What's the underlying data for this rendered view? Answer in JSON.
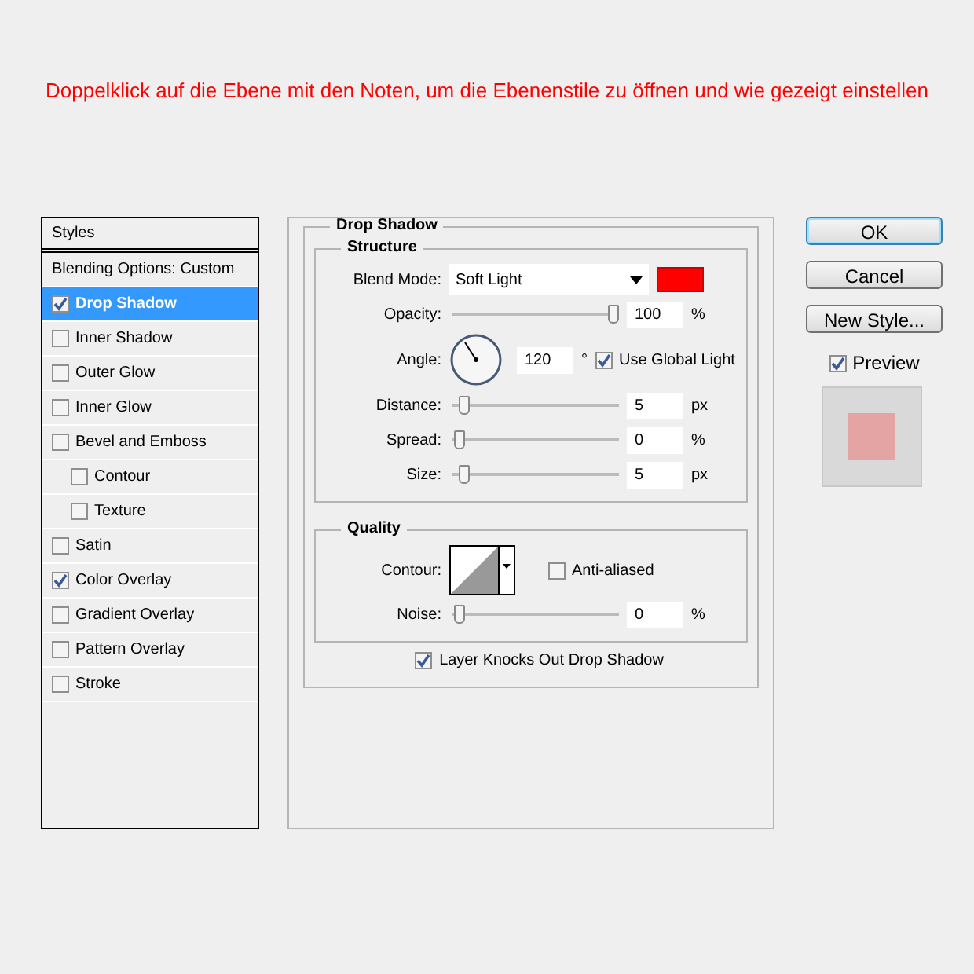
{
  "heading": "Doppelklick auf die Ebene mit den Noten, um die Ebenenstile zu öffnen und wie gezeigt einstellen",
  "styles_panel": {
    "title": "Styles",
    "blending_options": "Blending Options: Custom",
    "items": [
      {
        "label": "Drop Shadow",
        "checked": true,
        "selected": true
      },
      {
        "label": "Inner Shadow",
        "checked": false,
        "selected": false
      },
      {
        "label": "Outer Glow",
        "checked": false,
        "selected": false
      },
      {
        "label": "Inner Glow",
        "checked": false,
        "selected": false
      },
      {
        "label": "Bevel and Emboss",
        "checked": false,
        "selected": false,
        "children": [
          {
            "label": "Contour",
            "checked": false,
            "selected": false
          },
          {
            "label": "Texture",
            "checked": false,
            "selected": false
          }
        ]
      },
      {
        "label": "Satin",
        "checked": false,
        "selected": false
      },
      {
        "label": "Color Overlay",
        "checked": true,
        "selected": false
      },
      {
        "label": "Gradient Overlay",
        "checked": false,
        "selected": false
      },
      {
        "label": "Pattern Overlay",
        "checked": false,
        "selected": false
      },
      {
        "label": "Stroke",
        "checked": false,
        "selected": false
      }
    ]
  },
  "drop_shadow": {
    "title": "Drop Shadow",
    "structure": {
      "title": "Structure",
      "blend_mode": {
        "label": "Blend Mode:",
        "value": "Soft Light",
        "color": "#ff0000"
      },
      "opacity": {
        "label": "Opacity:",
        "level": 1,
        "value": "100",
        "unit": "%"
      },
      "angle": {
        "label": "Angle:",
        "value": "120",
        "unit": "°",
        "use_global_light": {
          "label": "Use Global Light",
          "checked": true
        }
      },
      "distance": {
        "label": "Distance:",
        "level": 0.03,
        "value": "5",
        "unit": "px"
      },
      "spread": {
        "label": "Spread:",
        "level": 0,
        "value": "0",
        "unit": "%"
      },
      "size": {
        "label": "Size:",
        "level": 0.03,
        "value": "5",
        "unit": "px"
      }
    },
    "quality": {
      "title": "Quality",
      "contour": {
        "label": "Contour:",
        "anti_aliased": {
          "label": "Anti-aliased",
          "checked": false
        }
      },
      "noise": {
        "label": "Noise:",
        "level": 0,
        "value": "0",
        "unit": "%"
      }
    },
    "layer_knocks_out": {
      "label": "Layer Knocks Out Drop Shadow",
      "checked": true
    }
  },
  "buttons": [
    {
      "label": "OK",
      "default": true
    },
    {
      "label": "Cancel",
      "default": false
    },
    {
      "label": "New Style...",
      "default": false
    }
  ],
  "preview": {
    "label": "Preview",
    "checked": true
  }
}
